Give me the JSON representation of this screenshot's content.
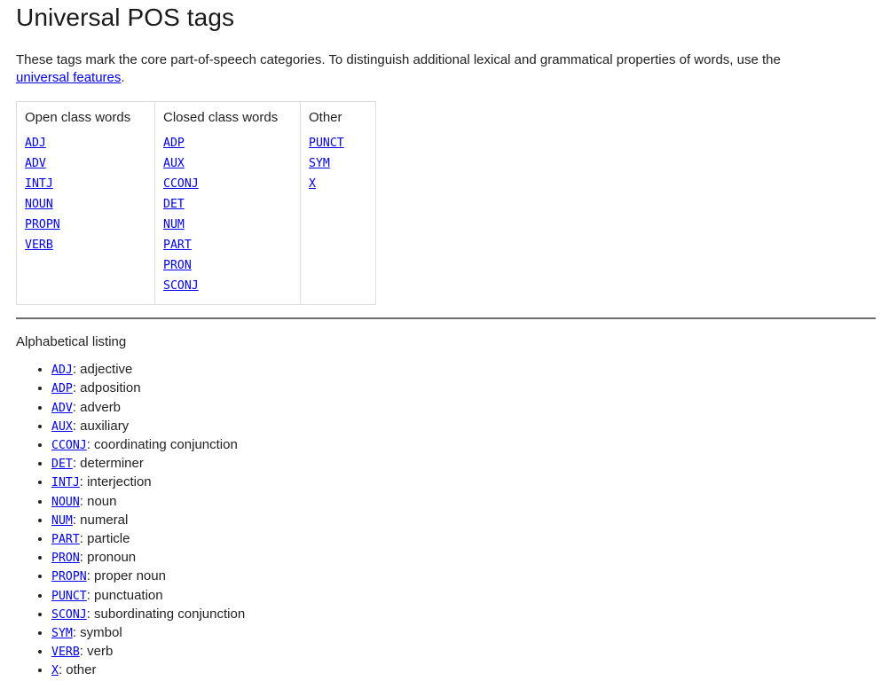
{
  "page": {
    "title": "Universal POS tags",
    "intro": {
      "before_link": "These tags mark the core part-of-speech categories. To distinguish additional lexical and grammatical properties of words, use the ",
      "link_text": "universal features",
      "after_link": "."
    }
  },
  "table": {
    "headers": [
      "Open class words",
      "Closed class words",
      "Other"
    ],
    "columns": [
      [
        "ADJ",
        "ADV",
        "INTJ",
        "NOUN",
        "PROPN",
        "VERB"
      ],
      [
        "ADP",
        "AUX",
        "CCONJ",
        "DET",
        "NUM",
        "PART",
        "PRON",
        "SCONJ"
      ],
      [
        "PUNCT",
        "SYM",
        "X"
      ]
    ]
  },
  "listing": {
    "label": "Alphabetical listing",
    "items": [
      {
        "tag": "ADJ",
        "desc": ": adjective"
      },
      {
        "tag": "ADP",
        "desc": ": adposition"
      },
      {
        "tag": "ADV",
        "desc": ": adverb"
      },
      {
        "tag": "AUX",
        "desc": ": auxiliary"
      },
      {
        "tag": "CCONJ",
        "desc": ": coordinating conjunction"
      },
      {
        "tag": "DET",
        "desc": ": determiner"
      },
      {
        "tag": "INTJ",
        "desc": ": interjection"
      },
      {
        "tag": "NOUN",
        "desc": ": noun"
      },
      {
        "tag": "NUM",
        "desc": ": numeral"
      },
      {
        "tag": "PART",
        "desc": ": particle"
      },
      {
        "tag": "PRON",
        "desc": ": pronoun"
      },
      {
        "tag": "PROPN",
        "desc": ": proper noun"
      },
      {
        "tag": "PUNCT",
        "desc": ": punctuation"
      },
      {
        "tag": "SCONJ",
        "desc": ": subordinating conjunction"
      },
      {
        "tag": "SYM",
        "desc": ": symbol"
      },
      {
        "tag": "VERB",
        "desc": ": verb"
      },
      {
        "tag": "X",
        "desc": ": other"
      }
    ]
  },
  "colors": {
    "link": "#0000EE",
    "text": "#222222",
    "table_border": "#DDDDDD",
    "rule": "#6D6D6D",
    "background": "#FFFFFF"
  }
}
